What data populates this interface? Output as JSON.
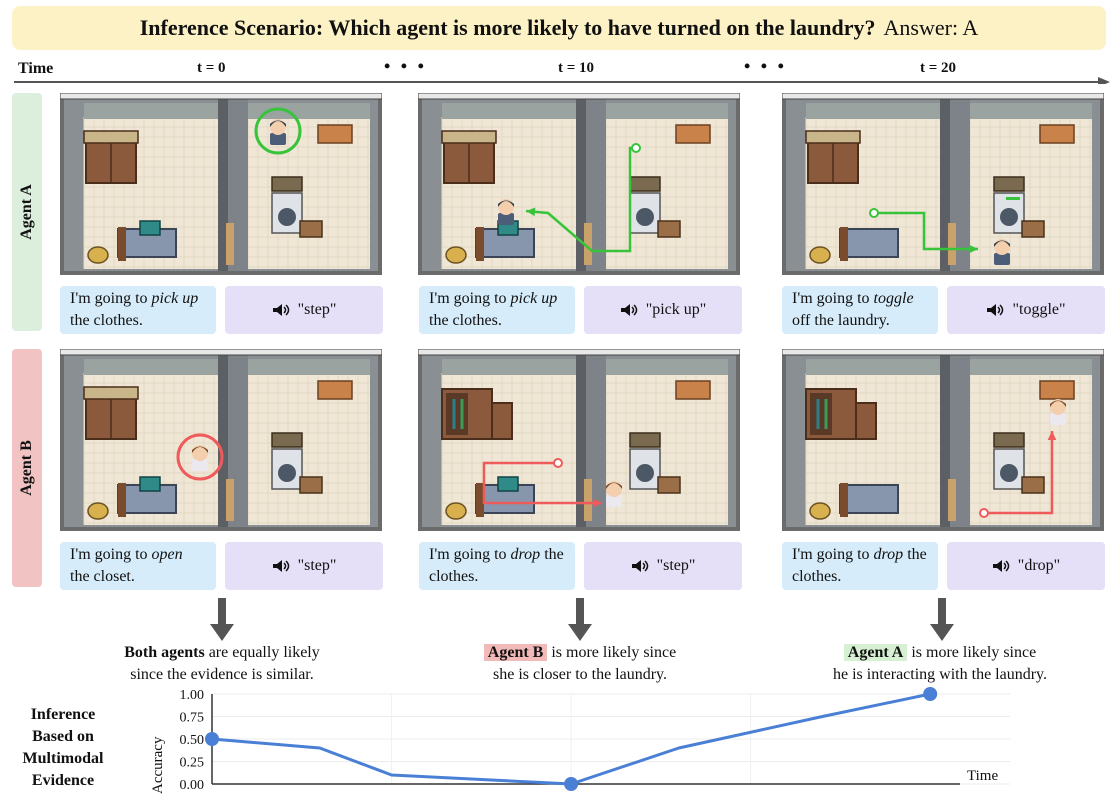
{
  "banner": {
    "question": "Inference Scenario: Which agent is more likely to have turned on the laundry?",
    "answer": "Answer: A"
  },
  "timeline": {
    "label": "Time",
    "ticks": [
      "t = 0",
      "t = 10",
      "t = 20"
    ],
    "ellipsis": "• • •"
  },
  "agents": {
    "a": {
      "label": "Agent A",
      "color": "#37c43a"
    },
    "b": {
      "label": "Agent B",
      "color": "#ef5a5a"
    }
  },
  "rows": {
    "a": [
      {
        "thought_pre": "I'm going to ",
        "thought_verb": "pick up",
        "thought_post": " the clothes.",
        "speech": "\"step\""
      },
      {
        "thought_pre": "I'm going to ",
        "thought_verb": "pick up",
        "thought_post": " the clothes.",
        "speech": "\"pick up\""
      },
      {
        "thought_pre": "I'm going to ",
        "thought_verb": "toggle",
        "thought_post": " off the laundry.",
        "speech": "\"toggle\""
      }
    ],
    "b": [
      {
        "thought_pre": "I'm going to ",
        "thought_verb": "open",
        "thought_post": " the closet.",
        "speech": "\"step\""
      },
      {
        "thought_pre": "I'm going to ",
        "thought_verb": "drop",
        "thought_post": " the clothes.",
        "speech": "\"step\""
      },
      {
        "thought_pre": "I'm going to ",
        "thought_verb": "drop",
        "thought_post": " the clothes.",
        "speech": "\"drop\""
      }
    ]
  },
  "verdicts": [
    {
      "bold": "Both agents",
      "rest1": " are equally likely",
      "rest2": "since the evidence is similar."
    },
    {
      "bold": "Agent B",
      "rest1": " is more likely since",
      "rest2": "she is closer to the laundry."
    },
    {
      "bold": "Agent A",
      "rest1": " is more likely since",
      "rest2": "he is interacting with the laundry."
    }
  ],
  "inference_label": [
    "Inference",
    "Based on",
    "Multimodal",
    "Evidence"
  ],
  "chart_data": {
    "type": "line",
    "x": [
      0,
      3,
      5,
      10,
      13,
      17,
      20
    ],
    "values": [
      0.5,
      0.4,
      0.1,
      0.0,
      0.4,
      0.75,
      1.0
    ],
    "highlighted_x": [
      0,
      10,
      20
    ],
    "xlabel": "Time",
    "ylabel": "Accuracy",
    "ylim": [
      0,
      1
    ],
    "yticks": [
      "0.00",
      "0.25",
      "0.50",
      "0.75",
      "1.00"
    ],
    "grid": true,
    "line_color": "#4a7fd6"
  }
}
